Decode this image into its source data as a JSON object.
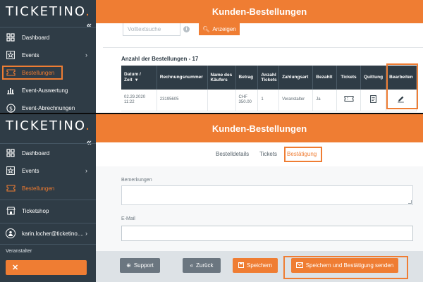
{
  "colors": {
    "accent": "#ef7d33",
    "sidebar": "#2f3c46",
    "header_dark": "#2f3c46",
    "footer_bg": "#dde2e6",
    "btn_grey": "#6b7680"
  },
  "logo": {
    "text": "TICKETINO",
    "dot": "."
  },
  "header_title": "Kunden-Bestellungen",
  "top": {
    "nav": [
      {
        "label": "Dashboard",
        "icon": "dashboard-icon"
      },
      {
        "label": "Events",
        "icon": "star-icon",
        "chevron": "›"
      },
      {
        "label": "Bestellungen",
        "icon": "ticket-icon",
        "active": true
      },
      {
        "label": "Event-Auswertung",
        "icon": "bar-chart-icon"
      },
      {
        "label": "Event-Abrechnungen",
        "icon": "dollar-icon"
      }
    ],
    "search_placeholder": "Volltextsuche",
    "info_icon": "i",
    "search_button": "Anzeigen",
    "orders_count_label": "Anzahl der Bestellungen - 17",
    "table": {
      "headers": [
        "Datum / Zeit",
        "Rechnungsnummer",
        "Name des Käufers",
        "Betrag",
        "Anzahl Tickets",
        "Zahlungsart",
        "Bezahlt",
        "Tickets",
        "Quittung",
        "Bearbeiten"
      ],
      "sort_indicator": "▼",
      "rows": [
        {
          "date": "02.29.2020 11:22",
          "invoice": "23195605",
          "buyer": "",
          "amount": "CHF 350.00",
          "tickets_count": "1",
          "payment": "Veranstalter",
          "paid": "Ja"
        }
      ]
    }
  },
  "bottom": {
    "nav": [
      {
        "label": "Dashboard",
        "icon": "dashboard-icon"
      },
      {
        "label": "Events",
        "icon": "star-icon",
        "chevron": "›"
      },
      {
        "label": "Bestellungen",
        "icon": "ticket-icon",
        "active": true
      },
      {
        "label": "Ticketshop",
        "icon": "shop-icon"
      },
      {
        "label": "karin.locher@ticketino....",
        "icon": "user-icon",
        "chevron": "›"
      }
    ],
    "role_label": "Veranstalter",
    "role_close": "✕",
    "tabs": [
      "Bestelldetails",
      "Tickets",
      "Bestätigung"
    ],
    "active_tab": 2,
    "remarks_label": "Bemerkungen",
    "email_label": "E-Mail",
    "email_value": "",
    "buttons": {
      "support": "Support",
      "back": "Zurück",
      "save": "Speichern",
      "save_send": "Speichern und Bestätigung senden"
    }
  }
}
